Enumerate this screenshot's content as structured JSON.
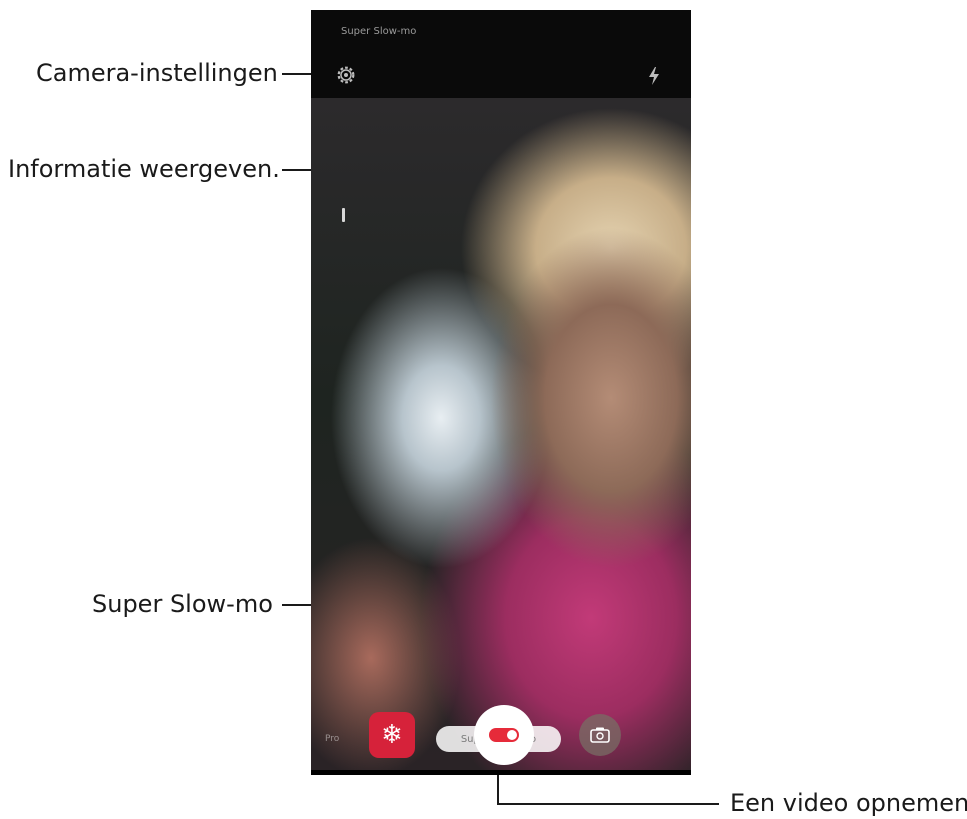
{
  "callouts": {
    "camera_settings": "Camera-instellingen",
    "show_info": "Informatie weergeven.",
    "super_slowmo": "Super Slow-mo",
    "record_video": "Een video opnemen."
  },
  "phone": {
    "mode_title": "Super Slow-mo",
    "mode_pill": "Super Slow-mo",
    "mode_left": "Pro",
    "effect_glyph": "❄",
    "icons": {
      "settings": "gear-icon",
      "flash": "flash-icon",
      "info": "info-icon",
      "effects": "snowflake-icon",
      "record": "record-icon",
      "switch_camera": "switch-camera-icon"
    }
  },
  "colors": {
    "record_accent": "#e62b3a",
    "effect_button": "#d6223a"
  }
}
